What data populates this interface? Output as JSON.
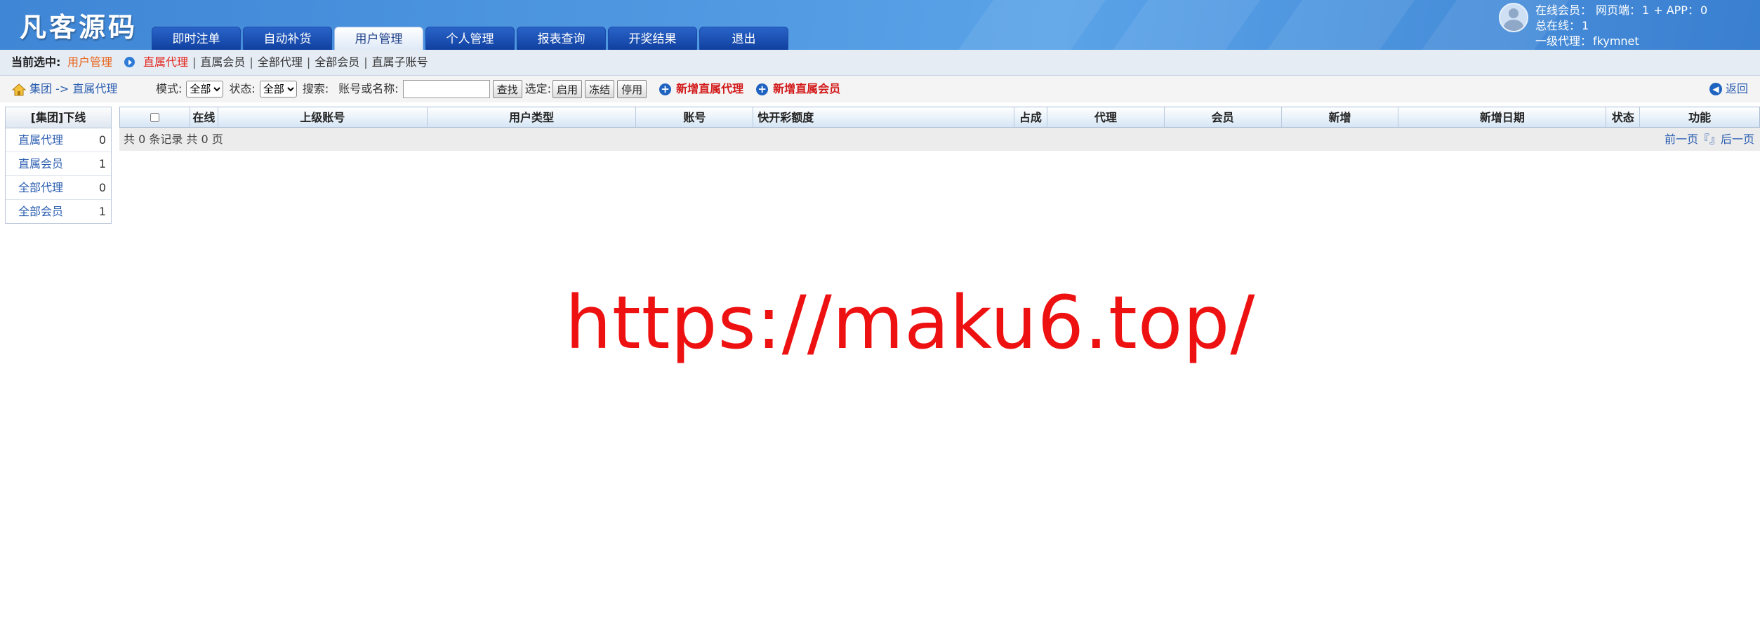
{
  "header": {
    "logo": "凡客源码",
    "tabs": [
      {
        "label": "即时注单",
        "active": false
      },
      {
        "label": "自动补货",
        "active": false
      },
      {
        "label": "用户管理",
        "active": true
      },
      {
        "label": "个人管理",
        "active": false
      },
      {
        "label": "报表查询",
        "active": false
      },
      {
        "label": "开奖结果",
        "active": false
      },
      {
        "label": "退出",
        "active": false
      }
    ],
    "user": {
      "online_label": "在线会员：",
      "web_label": "网页端：",
      "web_count": "1",
      "app_label": "+ APP：",
      "app_count": "0",
      "total_label": "总在线：",
      "total_count": "1",
      "agent_label": "一级代理：",
      "agent_name": "fkymnet"
    }
  },
  "selection_bar": {
    "label": "当前选中:",
    "current": "用户管理",
    "links": [
      "直属代理",
      "直属会员",
      "全部代理",
      "全部会员",
      "直属子账号"
    ],
    "active_link": "直属代理"
  },
  "toolbar": {
    "breadcrumb": "集团 -> 直属代理",
    "mode_label": "模式:",
    "mode_value": "全部",
    "status_label": "状态:",
    "status_value": "全部",
    "search_label": "搜索:",
    "search_field_label": "账号或名称:",
    "search_value": "",
    "find_button": "查找",
    "select_label": "选定:",
    "enable_button": "启用",
    "freeze_button": "冻结",
    "disable_button": "停用",
    "add_agent": "新增直属代理",
    "add_member": "新增直属会员",
    "back": "返回"
  },
  "sidebar": {
    "title": "[集团]下线",
    "items": [
      {
        "label": "直属代理",
        "count": "0"
      },
      {
        "label": "直属会员",
        "count": "1"
      },
      {
        "label": "全部代理",
        "count": "0"
      },
      {
        "label": "全部会员",
        "count": "1"
      }
    ]
  },
  "table": {
    "columns": [
      "",
      "在线",
      "上级账号",
      "用户类型",
      "账号",
      "快开彩额度",
      "占成",
      "代理",
      "会员",
      "新增",
      "新增日期",
      "状态",
      "功能"
    ],
    "summary": "共 0 条记录 共 0 页",
    "pager": "前一页『』后一页"
  },
  "watermark": "https://maku6.top/",
  "colors": {
    "accent": "#e2231a",
    "link": "#2a5db0",
    "header": "#4e97e0"
  }
}
